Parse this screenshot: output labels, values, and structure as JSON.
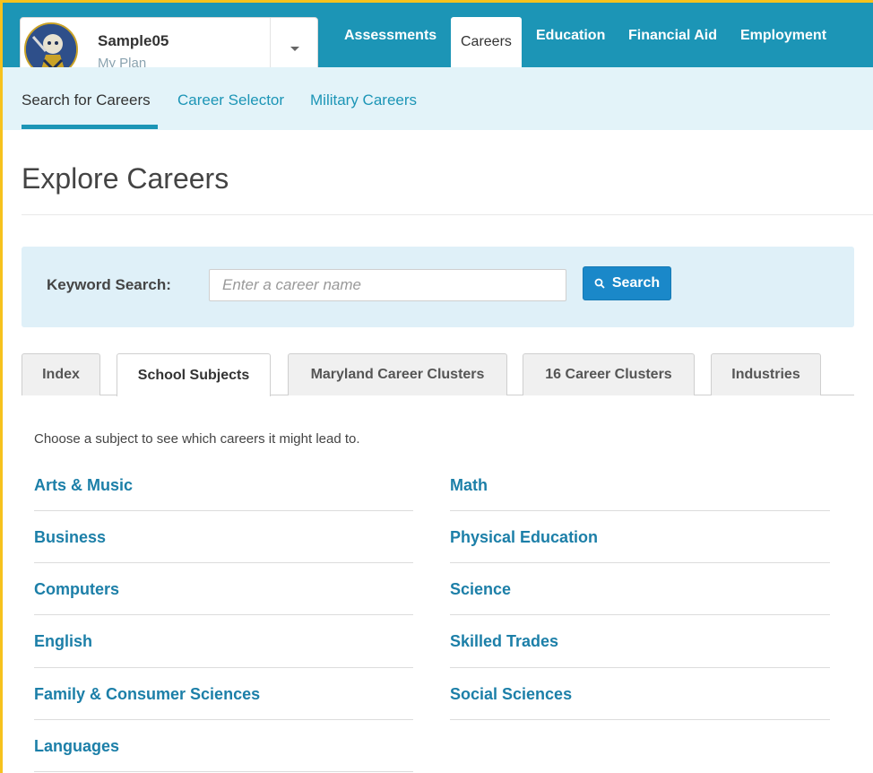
{
  "profile": {
    "name": "Sample05",
    "plan": "My Plan"
  },
  "nav": {
    "tabs": [
      "Assessments",
      "Careers",
      "Education",
      "Financial Aid",
      "Employment"
    ],
    "active": "Careers"
  },
  "subnav": {
    "items": [
      "Search for Careers",
      "Career Selector",
      "Military Careers"
    ],
    "active": "Search for Careers"
  },
  "page_title": "Explore Careers",
  "search": {
    "label": "Keyword Search:",
    "placeholder": "Enter a career name",
    "value": "",
    "button_label": "Search"
  },
  "tabs": {
    "items": [
      "Index",
      "School Subjects",
      "Maryland Career Clusters",
      "16 Career Clusters",
      "Industries"
    ],
    "active": "School Subjects"
  },
  "intro_text": "Choose a subject to see which careers it might lead to.",
  "subjects": {
    "left": [
      "Arts & Music",
      "Business",
      "Computers",
      "English",
      "Family & Consumer Sciences",
      "Languages"
    ],
    "right": [
      "Math",
      "Physical Education",
      "Science",
      "Skilled Trades",
      "Social Sciences"
    ]
  },
  "colors": {
    "brand": "#1c95b6",
    "link": "#1c7fa8",
    "subnav_bg": "#e3f3f9",
    "search_panel_bg": "#dff0f8",
    "search_button": "#1a88c9",
    "frame_border": "#f6c21d"
  }
}
